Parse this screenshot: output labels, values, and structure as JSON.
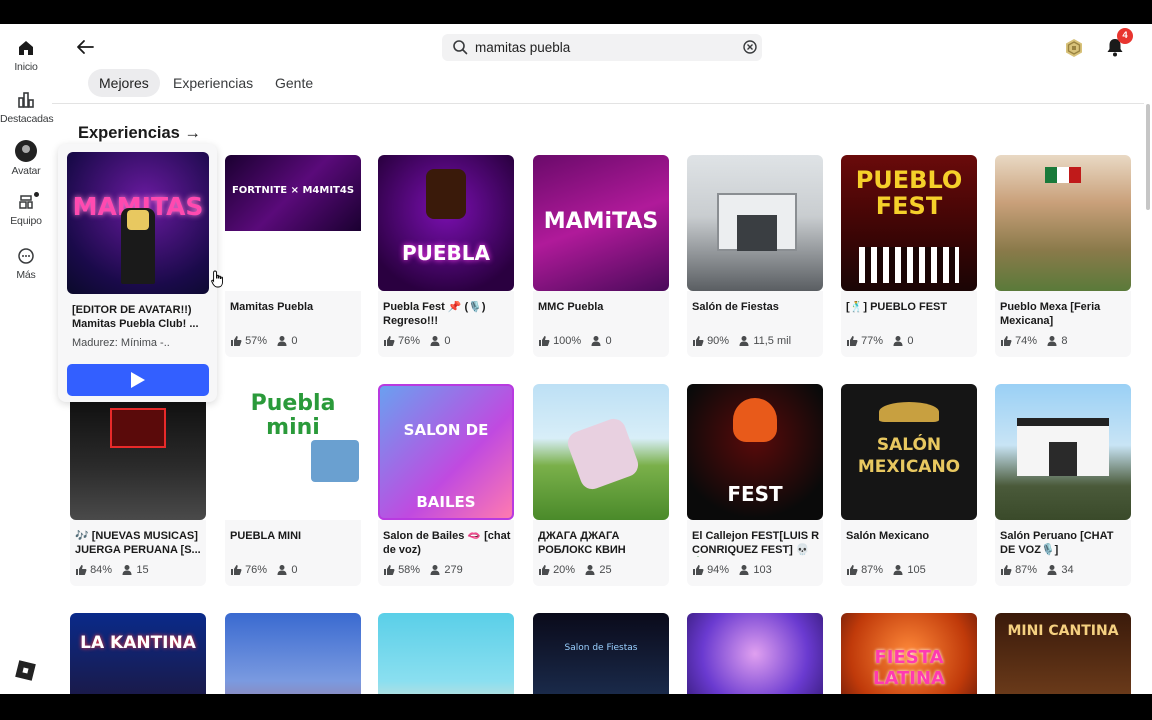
{
  "sidebar": {
    "items": [
      {
        "label": "Inicio",
        "icon": "home-icon"
      },
      {
        "label": "Destacadas",
        "icon": "charts-icon"
      },
      {
        "label": "Avatar",
        "icon": "avatar-icon"
      },
      {
        "label": "Equipo",
        "icon": "inventory-icon"
      },
      {
        "label": "Más",
        "icon": "more-icon"
      }
    ]
  },
  "search": {
    "value": "mamitas puebla"
  },
  "notifications": {
    "count": "4"
  },
  "tabs": [
    "Mejores",
    "Experiencias",
    "Gente"
  ],
  "section": {
    "title": "Experiencias"
  },
  "featured": {
    "name": "[EDITOR DE AVATAR!!) Mamitas Puebla Club! ...",
    "maturity": "Madurez: Mínima -..",
    "thumb_text": "MAMITAS"
  },
  "row1": [
    {
      "name": "Mamitas Puebla",
      "rating": "57%",
      "players": "0",
      "thumb_text": "FORTNITE × M4MIT4S"
    },
    {
      "name": "Puebla Fest 📌 (🎙️) Regreso!!!",
      "rating": "76%",
      "players": "0",
      "thumb_text": "PUEBLA"
    },
    {
      "name": "MMC Puebla",
      "rating": "100%",
      "players": "0",
      "thumb_text": "MAMiTAS"
    },
    {
      "name": "Salón de Fiestas",
      "rating": "90%",
      "players": "11,5 mil",
      "thumb_text": ""
    },
    {
      "name": "[🕺] PUEBLO FEST",
      "rating": "77%",
      "players": "0",
      "thumb_text": "PUEBLO FEST"
    },
    {
      "name": "Pueblo Mexa [Feria Mexicana]",
      "rating": "74%",
      "players": "8",
      "thumb_text": ""
    }
  ],
  "row2": [
    {
      "name": "🎶 [NUEVAS MUSICAS] JUERGA PERUANA [S...",
      "rating": "84%",
      "players": "15",
      "thumb_text": ""
    },
    {
      "name": "PUEBLA MINI",
      "rating": "76%",
      "players": "0",
      "thumb_text": "Puebla mini"
    },
    {
      "name": "Salon de Bailes 🫦 [chat de voz)",
      "rating": "58%",
      "players": "279",
      "thumb_text": "SALON DE BAILES"
    },
    {
      "name": "ДЖАГА ДЖАГА РОБЛОКС КВИН",
      "rating": "20%",
      "players": "25",
      "thumb_text": ""
    },
    {
      "name": "El Callejon FEST[LUIS R CONRIQUEZ FEST] 💀🎃",
      "rating": "94%",
      "players": "103",
      "thumb_text": "FEST"
    },
    {
      "name": "Salón Mexicano",
      "rating": "87%",
      "players": "105",
      "thumb_text": "SALÓN MEXICANO"
    },
    {
      "name": "Salón Peruano [CHAT DE VOZ🎙️]",
      "rating": "87%",
      "players": "34",
      "thumb_text": ""
    }
  ],
  "row3": [
    {
      "thumb_text": "LA KANTINA"
    },
    {
      "thumb_text": ""
    },
    {
      "thumb_text": ""
    },
    {
      "thumb_text": "Salon de Fiestas"
    },
    {
      "thumb_text": ""
    },
    {
      "thumb_text": "FIESTA LATINA"
    },
    {
      "thumb_text": "MINI CANTINA"
    }
  ],
  "colors": {
    "accent": "#335fff",
    "badge": "#e8352f"
  }
}
